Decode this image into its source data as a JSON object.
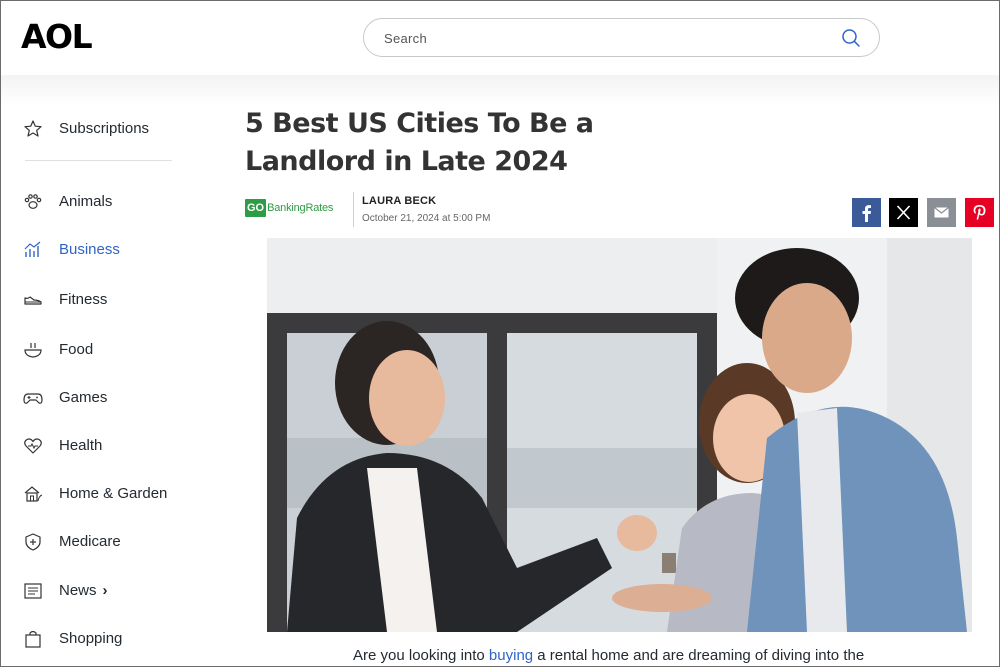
{
  "header": {
    "logo": "AOL",
    "search_placeholder": "Search"
  },
  "sidebar": {
    "items": [
      {
        "label": "Subscriptions",
        "icon": "star-icon"
      },
      {
        "label": "Animals",
        "icon": "paw-icon"
      },
      {
        "label": "Business",
        "icon": "chart-icon"
      },
      {
        "label": "Fitness",
        "icon": "sneaker-icon"
      },
      {
        "label": "Food",
        "icon": "bowl-icon"
      },
      {
        "label": "Games",
        "icon": "gamepad-icon"
      },
      {
        "label": "Health",
        "icon": "heart-icon"
      },
      {
        "label": "Home & Garden",
        "icon": "house-icon"
      },
      {
        "label": "Medicare",
        "icon": "shield-plus-icon"
      },
      {
        "label": "News",
        "icon": "newspaper-icon",
        "chevron": "›"
      },
      {
        "label": "Shopping",
        "icon": "bag-icon"
      }
    ],
    "active": "Business"
  },
  "article": {
    "title": "5 Best US Cities To Be a Landlord in Late 2024",
    "source_go": "GO",
    "source_name": "BankingRates",
    "author": "LAURA BECK",
    "date": "October 21, 2024 at 5:00 PM",
    "body_before": "Are you looking into ",
    "body_link": "buying",
    "body_after": " a rental home and are dreaming of diving into the"
  },
  "share": [
    "facebook-icon",
    "x-icon",
    "mail-icon",
    "pinterest-icon"
  ],
  "colors": {
    "accent": "#2f64c6",
    "facebook": "#3a5a98",
    "x": "#000000",
    "mail": "#8a8f96",
    "pinterest": "#e60023",
    "source_green": "#2e9b45"
  }
}
